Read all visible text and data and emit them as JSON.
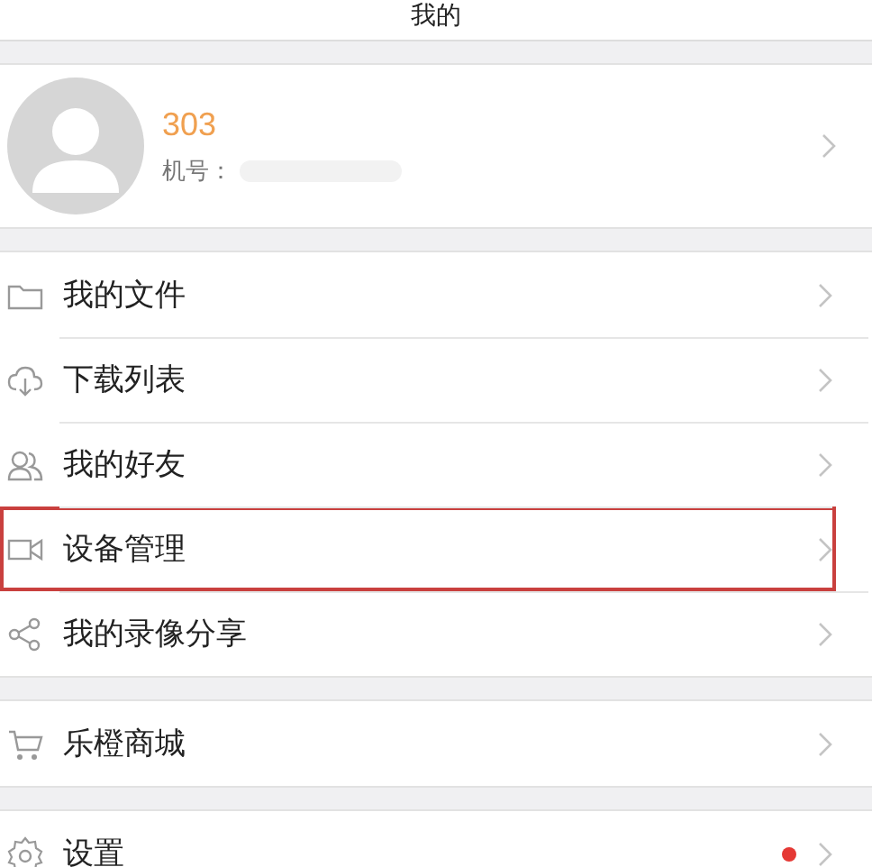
{
  "header": {
    "title": "我的"
  },
  "profile": {
    "name": "303",
    "phone_label": "机号："
  },
  "sections": [
    {
      "items": [
        {
          "label": "我的文件",
          "highlighted": false,
          "badge_dot": false
        },
        {
          "label": "下载列表",
          "highlighted": false,
          "badge_dot": false
        },
        {
          "label": "我的好友",
          "highlighted": false,
          "badge_dot": false
        },
        {
          "label": "设备管理",
          "highlighted": true,
          "badge_dot": false
        },
        {
          "label": "我的录像分享",
          "highlighted": false,
          "badge_dot": false
        }
      ]
    },
    {
      "items": [
        {
          "label": "乐橙商城",
          "highlighted": false,
          "badge_dot": false
        }
      ]
    },
    {
      "items": [
        {
          "label": "设置",
          "highlighted": false,
          "badge_dot": true
        }
      ]
    }
  ]
}
